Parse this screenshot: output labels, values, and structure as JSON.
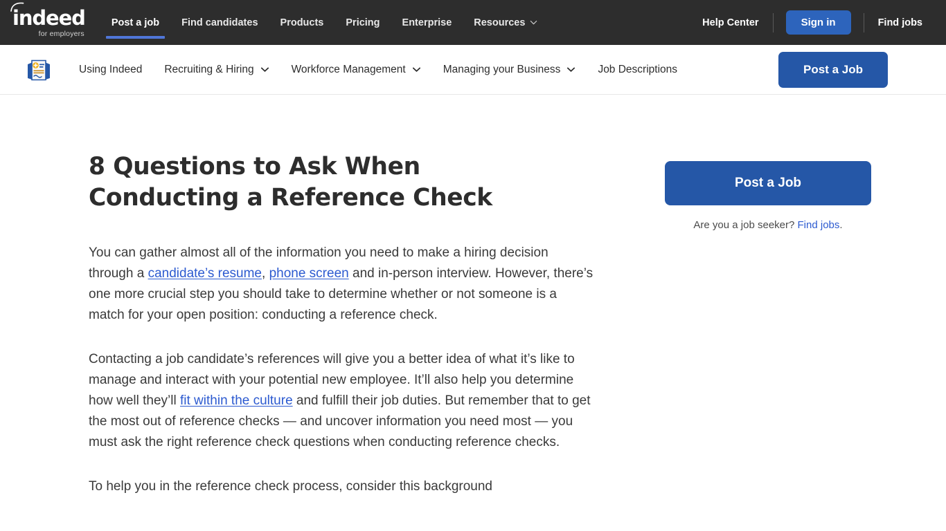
{
  "topnav": {
    "logo": {
      "word": "indeed",
      "sub": "for employers",
      "icon": "indeed-logo-arc-icon"
    },
    "links": [
      {
        "label": "Post a job",
        "active": true,
        "chevron": false
      },
      {
        "label": "Find candidates",
        "active": false,
        "chevron": false
      },
      {
        "label": "Products",
        "active": false,
        "chevron": false
      },
      {
        "label": "Pricing",
        "active": false,
        "chevron": false
      },
      {
        "label": "Enterprise",
        "active": false,
        "chevron": false
      },
      {
        "label": "Resources",
        "active": false,
        "chevron": true
      }
    ],
    "help_center": "Help Center",
    "sign_in": "Sign in",
    "find_jobs": "Find jobs",
    "bg_color": "#2d2d2d",
    "accent_color": "#5076d8",
    "signin_color": "#2d64bc"
  },
  "subnav": {
    "logo_icon": "job-posting-document-icon",
    "links": [
      {
        "label": "Using Indeed",
        "chevron": false
      },
      {
        "label": "Recruiting & Hiring",
        "chevron": true
      },
      {
        "label": "Workforce Management",
        "chevron": true
      },
      {
        "label": "Managing your Business",
        "chevron": true
      },
      {
        "label": "Job Descriptions",
        "chevron": false
      }
    ],
    "post_a_job": "Post a Job",
    "button_color": "#2557a7"
  },
  "article": {
    "title": "8 Questions to Ask When Conducting a Reference Check",
    "p1": {
      "part1": "You can gather almost all of the information you need to make a hiring decision through a ",
      "link1": "candidate’s resume",
      "part2": ", ",
      "link2": "phone screen",
      "part3": " and in-person interview. However, there’s one more crucial step you should take to determine whether or not someone is a match for your open position: conducting a reference check."
    },
    "p2": {
      "part1": "Contacting a job candidate’s references will give you a better idea of what it’s like to manage and interact with your potential new employee. It’ll also help you determine how well they’ll ",
      "link1": "fit within the culture",
      "part2": " and fulfill their job duties. But remember that to get the most out of reference checks — and uncover information you need most — you must ask the right reference check questions when conducting reference checks."
    },
    "p3": "To help you in the reference check process, consider this background",
    "link_color": "#2c5ad0"
  },
  "sidebar": {
    "post_a_job": "Post a Job",
    "note_prefix": "Are you a job seeker? ",
    "note_link": "Find jobs",
    "note_suffix": ".",
    "button_color": "#2557a7"
  }
}
